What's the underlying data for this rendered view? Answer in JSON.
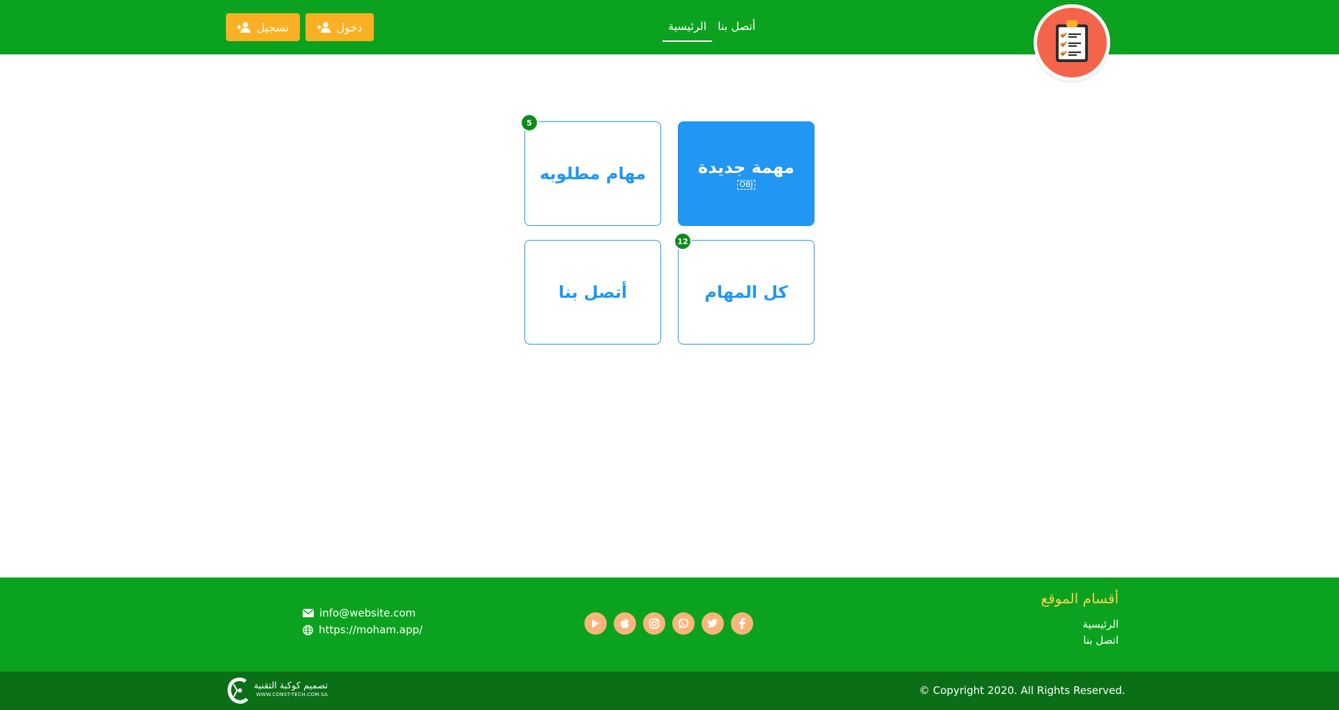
{
  "header": {
    "nav": [
      {
        "label": "الرئيسية",
        "active": true
      },
      {
        "label": "أتصل بنا",
        "active": false
      }
    ],
    "login_label": "دخول",
    "register_label": "تسجيل",
    "logo_icon": "clipboard-checklist-icon"
  },
  "tiles": [
    {
      "label": "مهمة جديدة",
      "sub": "OBJ"
    },
    {
      "label": "مهام مطلوبه",
      "badge": "5"
    },
    {
      "label": "كل المهام",
      "badge": "12"
    },
    {
      "label": "أتصل بنا"
    }
  ],
  "footer": {
    "title": "أقسام الموقع",
    "links": [
      "الرئيسية",
      "اتصل بنا"
    ],
    "social": [
      "facebook-icon",
      "twitter-icon",
      "whatsapp-icon",
      "instagram-icon",
      "apple-icon",
      "google-play-icon"
    ],
    "email": "info@website.com",
    "website": "https://moham.app/",
    "copyright": "© Copyright 2020. All Rights Reserved.",
    "credit_name": "تصميم كوكبة التقنية",
    "credit_url": "WWW.CONST-TECH.COM.SA"
  },
  "colors": {
    "header_green": "#0ba21f",
    "footer_bottom": "#0a6f17",
    "accent_orange": "#fbb023",
    "tile_blue": "#2196f3",
    "logo_coral": "#f4644a",
    "social_bg": "#fbb57a"
  }
}
